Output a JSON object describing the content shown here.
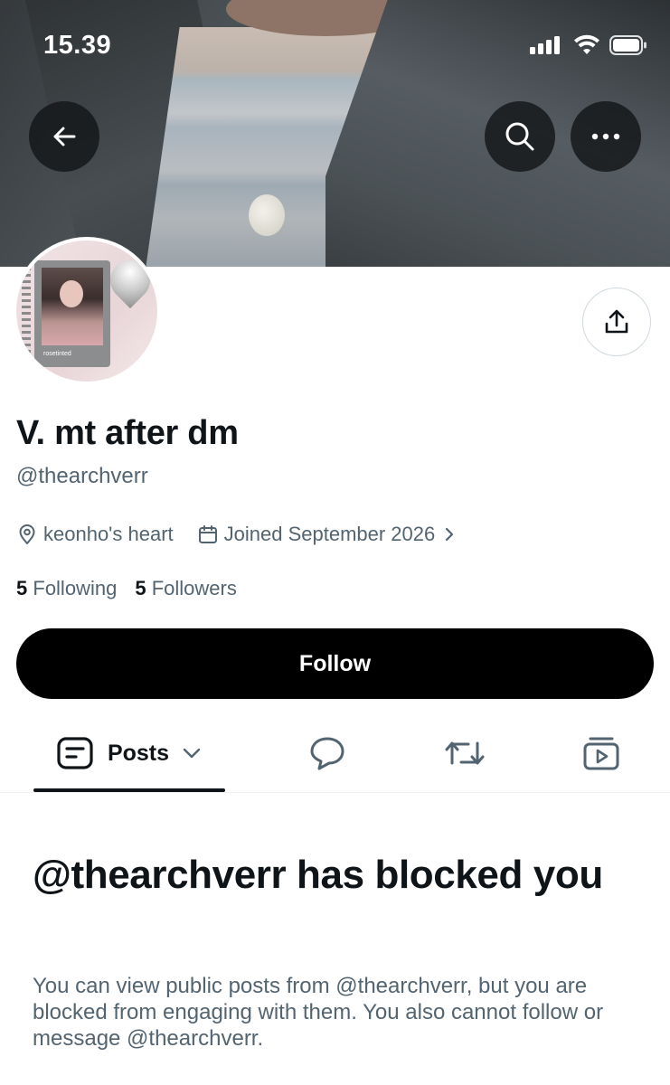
{
  "status_bar": {
    "time": "15.39",
    "signal_icon": "cellular-signal-icon",
    "wifi_icon": "wifi-icon",
    "battery_icon": "battery-icon"
  },
  "header": {
    "back_icon": "back-arrow-icon",
    "search_icon": "search-icon",
    "more_icon": "more-options-icon"
  },
  "profile": {
    "avatar_caption": "rosetinted",
    "name": "V. mt after dm",
    "handle": "@thearchverr",
    "location": "keonho's heart",
    "joined": "Joined September 2026",
    "following_count": "5",
    "following_label": "Following",
    "followers_count": "5",
    "followers_label": "Followers",
    "share_icon": "share-icon"
  },
  "actions": {
    "follow_label": "Follow"
  },
  "tabs": [
    {
      "label": "Posts",
      "icon": "posts-icon",
      "active": true
    },
    {
      "label": "",
      "icon": "replies-bubble-icon",
      "active": false
    },
    {
      "label": "",
      "icon": "repost-icon",
      "active": false
    },
    {
      "label": "",
      "icon": "media-video-icon",
      "active": false
    }
  ],
  "blocked": {
    "title": "@thearchverr has blocked you",
    "message": "You can view public posts from @thearchverr, but you are blocked from engaging with them. You also cannot follow or message @thearchverr."
  },
  "colors": {
    "primary_text": "#0f1419",
    "secondary_text": "#536471",
    "follow_button_bg": "#000000",
    "divider": "#eff3f4"
  }
}
